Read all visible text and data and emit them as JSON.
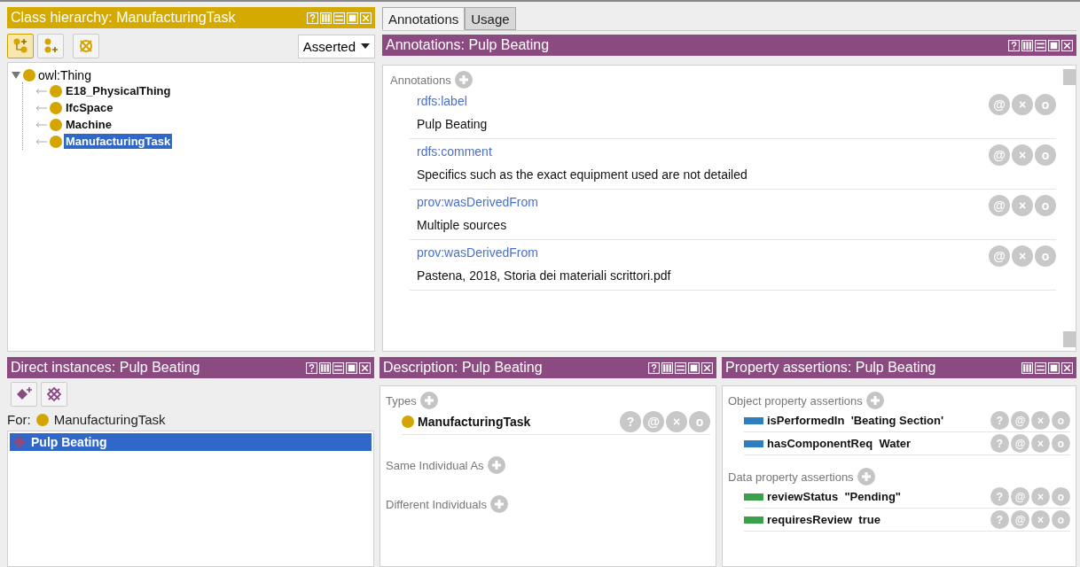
{
  "class_hierarchy": {
    "title": "Class hierarchy: ManufacturingTask",
    "help_button": true,
    "view_dropdown": "Asserted",
    "tree": {
      "label": "owl:Thing",
      "expanded": true,
      "children": [
        {
          "label": "E18_PhysicalThing",
          "selected": false
        },
        {
          "label": "IfcSpace",
          "selected": false
        },
        {
          "label": "Machine",
          "selected": false
        },
        {
          "label": "ManufacturingTask",
          "selected": true
        }
      ]
    }
  },
  "tabs": [
    {
      "label": "Annotations",
      "selected": true
    },
    {
      "label": "Usage",
      "selected": false
    }
  ],
  "annotations": {
    "title": "Annotations: Pulp Beating",
    "help_button": true,
    "section_label": "Annotations",
    "items": [
      {
        "property": "rdfs:label",
        "value": "Pulp Beating",
        "actions": [
          "@",
          "×",
          "o"
        ]
      },
      {
        "property": "rdfs:comment",
        "value": "Specifics such as the exact equipment used are not detailed",
        "actions": [
          "@",
          "×",
          "o"
        ]
      },
      {
        "property": "prov:wasDerivedFrom",
        "value": "Multiple sources",
        "actions": [
          "@",
          "×",
          "o"
        ]
      },
      {
        "property": "prov:wasDerivedFrom",
        "value": "Pastena, 2018, Storia dei materiali scrittori.pdf",
        "actions": [
          "@",
          "×",
          "o"
        ]
      }
    ]
  },
  "direct_instances": {
    "title": "Direct instances: Pulp Beating",
    "help_button": true,
    "for_label": "For:",
    "for_class": "ManufacturingTask",
    "items": [
      {
        "label": "Pulp Beating",
        "selected": true
      }
    ]
  },
  "description": {
    "title": "Description: Pulp Beating",
    "help_button": true,
    "sections": [
      {
        "label": "Types",
        "items": [
          {
            "label": "ManufacturingTask",
            "actions": [
              "?",
              "@",
              "×",
              "o"
            ]
          }
        ]
      },
      {
        "label": "Same Individual As"
      },
      {
        "label": "Different Individuals"
      }
    ]
  },
  "property_assertions": {
    "title": "Property assertions: Pulp Beating",
    "help_button": false,
    "sections": [
      {
        "label": "Object property assertions",
        "kind": "object",
        "items": [
          {
            "text": "isPerformedIn  'Beating Section'",
            "actions": [
              "?",
              "@",
              "×",
              "o"
            ]
          },
          {
            "text": "hasComponentReq  Water",
            "actions": [
              "?",
              "@",
              "×",
              "o"
            ]
          }
        ]
      },
      {
        "label": "Data property assertions",
        "kind": "data",
        "items": [
          {
            "text": "reviewStatus  \"Pending\"",
            "actions": [
              "?",
              "@",
              "×",
              "o"
            ]
          },
          {
            "text": "requiresReview  true",
            "actions": [
              "?",
              "@",
              "×",
              "o"
            ]
          }
        ]
      }
    ]
  }
}
